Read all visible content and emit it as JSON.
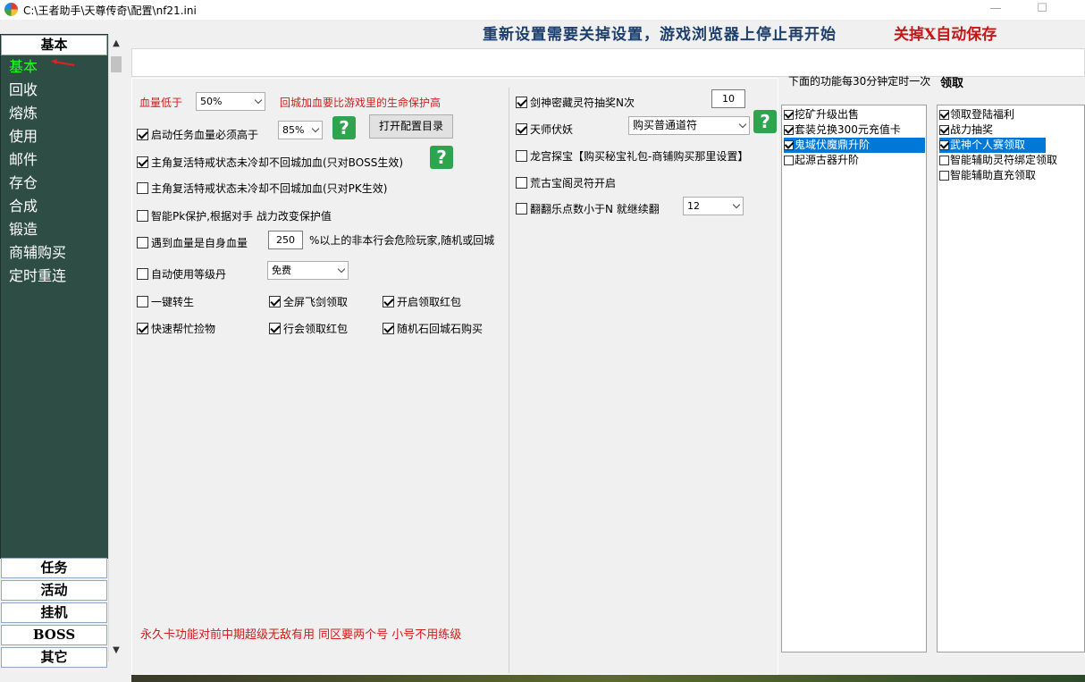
{
  "window": {
    "title": "C:\\王者助手\\天尊传奇\\配置\\nf21.ini",
    "minimize": "—",
    "maximize": "☐"
  },
  "nav": {
    "top_button": "基本",
    "items": [
      "基本",
      "回收",
      "熔炼",
      "使用",
      "邮件",
      "存仓",
      "合成",
      "锻造",
      "商辅购买",
      "定时重连"
    ],
    "bottom_buttons": [
      "任务",
      "活动",
      "挂机",
      "BOSS",
      "其它"
    ]
  },
  "banner": {
    "notice": "重新设置需要关掉设置，游戏浏览器上停止再开始",
    "autosave": "关掉X自动保存"
  },
  "basic": {
    "hp_low_label": "血量低于",
    "hp_low_value": "50%",
    "hp_note": "回城加血要比游戏里的生命保护高",
    "task_hp_label": "启动任务血量必须高于",
    "task_hp_value": "85%",
    "open_config_dir": "打开配置目录",
    "revive_boss": "主角复活特戒状态未冷却不回城加血(只对BOSS生效)",
    "revive_pk": "主角复活特戒状态未冷却不回城加血(只对PK生效)",
    "smart_pk": "智能Pk保护,根据对手 战力改变保护值",
    "self_hp_label": "遇到血量是自身血量",
    "self_hp_value": "250",
    "self_hp_suffix": "%以上的非本行会危险玩家,随机或回城",
    "auto_level_pill": "自动使用等级丹",
    "level_pill_value": "免费",
    "one_click_rebirth": "一键转生",
    "fullscreen_sword": "全屏飞剑领取",
    "open_red_packet": "开启领取红包",
    "quick_pickup": "快速帮忙捡物",
    "guild_red_packet": "行会领取红包",
    "random_stone": "随机石回城石购买",
    "footer_note": "永久卡功能对前中期超级无敌有用 同区要两个号 小号不用练级",
    "help_glyph": "?"
  },
  "middle": {
    "sword_lottery": "剑神密藏灵符抽奖N次",
    "sword_lottery_value": "10",
    "master_demon": "天师伏妖",
    "master_demon_value": "购买普通道符",
    "dragon_palace": "龙宫探宝【购买秘宝礼包-商铺购买那里设置】",
    "ancient_pavilion": "荒古宝阁灵符开启",
    "flip_label": "翻翻乐点数小于N 就继续翻",
    "flip_value": "12"
  },
  "timed": {
    "title": "下面的功能每30分钟定时一次",
    "items": [
      {
        "label": "挖矿升级出售",
        "checked": true,
        "selected": false
      },
      {
        "label": "套装兑换300元充值卡",
        "checked": true,
        "selected": false
      },
      {
        "label": "鬼域伏魔鼎升阶",
        "checked": true,
        "selected": true
      },
      {
        "label": "起源古器升阶",
        "checked": false,
        "selected": false
      }
    ]
  },
  "claim": {
    "title": "领取",
    "items": [
      {
        "label": "领取登陆福利",
        "checked": true,
        "selected": false
      },
      {
        "label": "战力抽奖",
        "checked": true,
        "selected": false
      },
      {
        "label": "武神个人赛领取",
        "checked": true,
        "selected": true
      },
      {
        "label": "智能辅助灵符绑定领取",
        "checked": false,
        "selected": false
      },
      {
        "label": "智能辅助直充领取",
        "checked": false,
        "selected": false
      }
    ]
  }
}
